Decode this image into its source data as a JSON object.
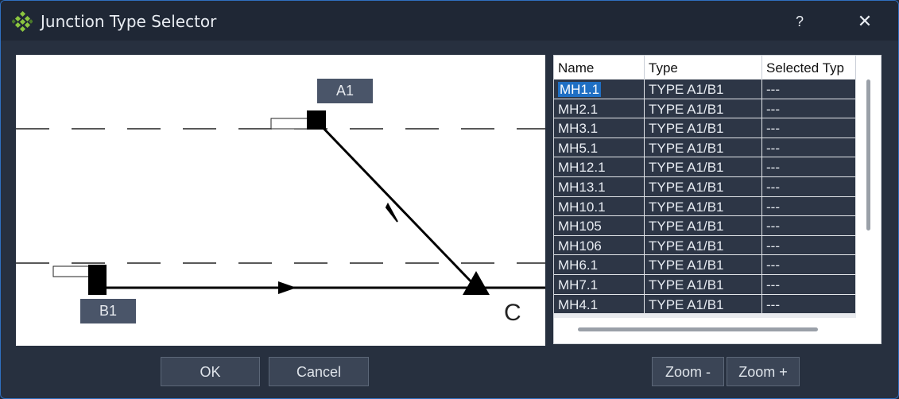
{
  "window": {
    "title": "Junction Type Selector",
    "help": "?",
    "close": "✕"
  },
  "diagram": {
    "labels": {
      "a": "A1",
      "b": "B1",
      "c": "C"
    }
  },
  "table": {
    "columns": [
      "Name",
      "Type",
      "Selected Typ"
    ],
    "rows": [
      [
        "MH1.1",
        "TYPE A1/B1",
        "---"
      ],
      [
        "MH2.1",
        "TYPE A1/B1",
        "---"
      ],
      [
        "MH3.1",
        "TYPE A1/B1",
        "---"
      ],
      [
        "MH5.1",
        "TYPE A1/B1",
        "---"
      ],
      [
        "MH12.1",
        "TYPE A1/B1",
        "---"
      ],
      [
        "MH13.1",
        "TYPE A1/B1",
        "---"
      ],
      [
        "MH10.1",
        "TYPE A1/B1",
        "---"
      ],
      [
        "MH105",
        "TYPE A1/B1",
        "---"
      ],
      [
        "MH106",
        "TYPE A1/B1",
        "---"
      ],
      [
        "MH6.1",
        "TYPE A1/B1",
        "---"
      ],
      [
        "MH7.1",
        "TYPE A1/B1",
        "---"
      ],
      [
        "MH4.1",
        "TYPE A1/B1",
        "---"
      ]
    ],
    "selected_row": 0
  },
  "buttons": {
    "ok": "OK",
    "cancel": "Cancel",
    "zoom_out": "Zoom -",
    "zoom_in": "Zoom +"
  },
  "colors": {
    "accent": "#1f6fc4",
    "row_bg": "#2d3646",
    "window_bg": "#27303f"
  }
}
